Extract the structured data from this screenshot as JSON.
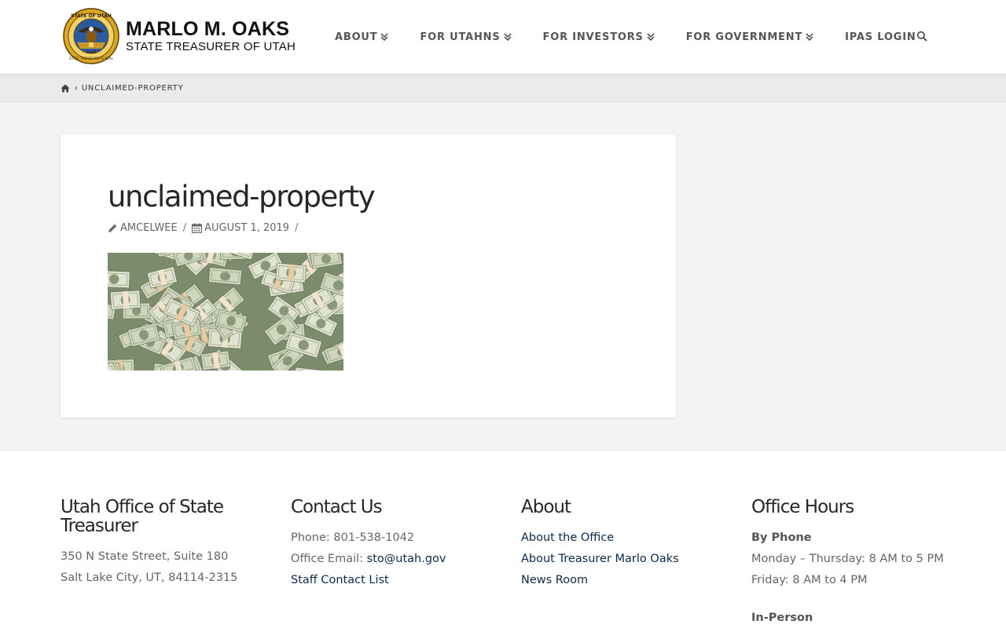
{
  "header": {
    "brand_name": "MARLO M. OAKS",
    "brand_sub": "STATE TREASURER OF UTAH",
    "seal_top": "STATE OF UTAH",
    "seal_bottom": "STATE TREASURER'S SEAL",
    "seal_year": "1850",
    "nav": [
      {
        "label": "ABOUT",
        "has_menu": true
      },
      {
        "label": "FOR UTAHNS",
        "has_menu": true
      },
      {
        "label": "FOR INVESTORS",
        "has_menu": true
      },
      {
        "label": "FOR GOVERNMENT",
        "has_menu": true
      },
      {
        "label": "IPAS LOGIN",
        "has_menu": false
      }
    ],
    "search_icon": "search-icon"
  },
  "breadcrumb": {
    "home_icon": "home-icon",
    "current": "UNCLAIMED-PROPERTY"
  },
  "post": {
    "title": "unclaimed-property",
    "author": "AMCELWEE",
    "date": "AUGUST 1, 2019",
    "image_subject": "stacks of hundred dollar bills"
  },
  "footer": {
    "office": {
      "heading_line1": "Utah Office of State",
      "heading_line2": "Treasurer",
      "address1": "350 N State Street, Suite 180",
      "address2": "Salt Lake City, UT, 84114-2315"
    },
    "contact": {
      "heading": "Contact Us",
      "phone": "Phone: 801-538-1042",
      "email_label": "Office Email: ",
      "email": "sto@utah.gov",
      "staff_link": "Staff Contact List"
    },
    "about": {
      "heading": "About",
      "links": [
        "About the Office",
        "About Treasurer Marlo Oaks",
        "News Room"
      ]
    },
    "hours": {
      "heading": "Office Hours",
      "phone_heading": "By Phone",
      "line1": "Monday – Thursday: 8 AM to 5 PM",
      "line2": "Friday: 8 AM to 4 PM",
      "inperson_heading": "In-Person"
    }
  },
  "colors": {
    "link": "#0b2a4a",
    "gold": "#d3a21b",
    "seal_blue": "#1e4a8a"
  }
}
